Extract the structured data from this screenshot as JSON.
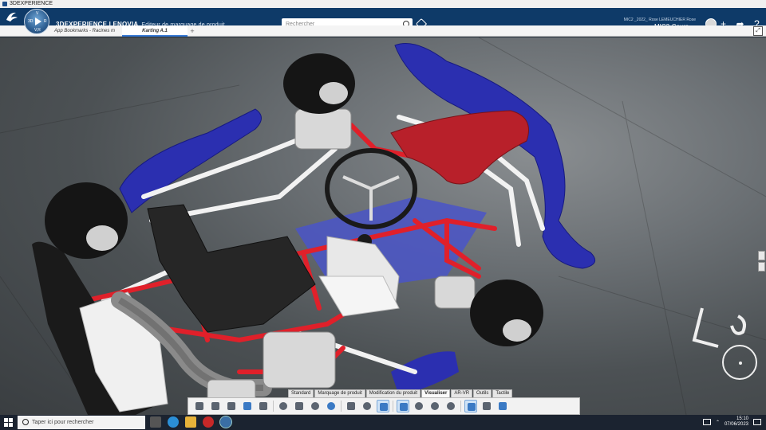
{
  "os": {
    "window_title": "3DEXPERIENCE"
  },
  "app": {
    "brand_bold": "3DEXPERIENCE | ENOVIA",
    "brand_sub": "Editeur de marquage de produit",
    "compass_labels": {
      "v": "V",
      "r": "R",
      "label_3d": "3D",
      "vr": "V,R"
    },
    "search_placeholder": "Rechercher",
    "user_line": "MIC2 _2022_ Rose LEMEUCHIER Rose",
    "workspace": "MIC2-Cours",
    "colors": {
      "topbar": "#0e3a68",
      "accent": "#3a7bd5"
    }
  },
  "tabs": [
    {
      "label": "App Bookmarks - Racines m"
    },
    {
      "label": "Karting A.1",
      "active": true
    }
  ],
  "action_tabs": [
    "Standard",
    "Marquage de produit",
    "Modification du produit",
    "Visualiser",
    "AR-VR",
    "Outils",
    "Tactile"
  ],
  "active_action_tab": "Visualiser",
  "toolbar_icons": [
    "cut-icon",
    "copy-icon",
    "paste-icon",
    "undo-icon",
    "share-icon",
    "zoom-icon",
    "pan-icon",
    "rotate-icon",
    "search-icon",
    "capture-icon",
    "view-icon",
    "cube-icon",
    "material-icon",
    "globe-icon",
    "render-icon",
    "settings-icon",
    "select-icon",
    "tree-icon",
    "box-icon"
  ],
  "viewport": {
    "model_name": "Karting A.1",
    "colors": {
      "frame": "#e0202a",
      "bodywork": "#2b2fb0",
      "seat": "#b8202a",
      "tires": "#151515"
    }
  },
  "taskbar": {
    "search_placeholder": "Taper ici pour rechercher",
    "time": "15:10",
    "date": "07/06/2023"
  }
}
